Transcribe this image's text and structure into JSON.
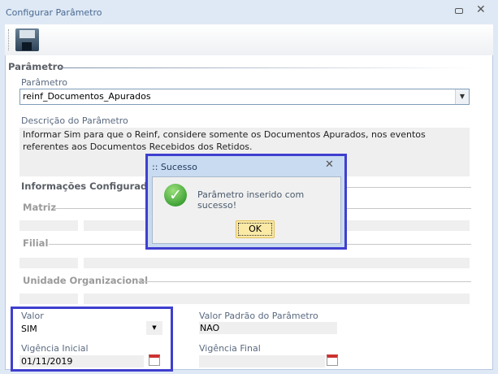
{
  "window": {
    "title": "Configurar Parâmetro",
    "minimize_icon": "minimize-icon",
    "close_icon": "close-icon"
  },
  "toolbar": {
    "save_icon": "floppy-save-icon"
  },
  "parametro_section": {
    "title": "Parâmetro",
    "parametro_label": "Parâmetro",
    "parametro_value": "reinf_Documentos_Apurados",
    "descricao_label": "Descrição do Parâmetro",
    "descricao_value": "Informar Sim para que o Reinf, considere somente os Documentos Apurados, nos eventos referentes aos Documentos Recebidos dos Retidos."
  },
  "info_section": {
    "title": "Informações Configuradas",
    "matriz": "Matriz",
    "filial": "Filial",
    "unidade": "Unidade Organizacional"
  },
  "valor": {
    "label": "Valor",
    "value": "SIM",
    "padrao_label": "Valor Padrão do Parâmetro",
    "padrao_value": "NAO",
    "vig_inicial_label": "Vigência Inicial",
    "vig_inicial_value": "01/11/2019",
    "vig_final_label": "Vigência Final",
    "vig_final_value": ""
  },
  "dialog": {
    "title": ":: Sucesso",
    "message": "Parâmetro inserido com sucesso!",
    "ok_label": "OK"
  },
  "colors": {
    "highlight": "#3f3fcf",
    "ok_button": "#fbe9a6"
  }
}
